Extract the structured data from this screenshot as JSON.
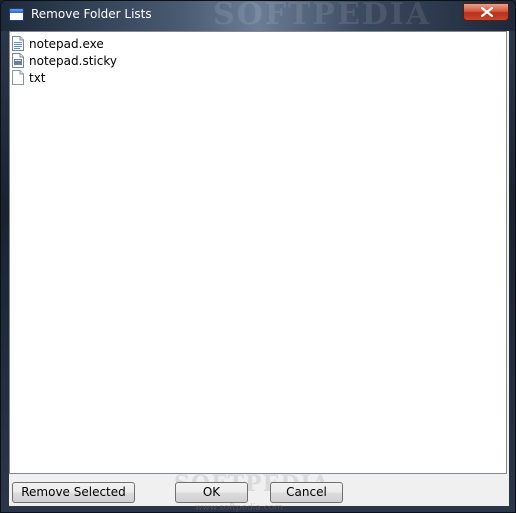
{
  "window": {
    "title": "Remove Folder Lists",
    "close_label": "close"
  },
  "watermark": {
    "top": "SOFTPEDIA",
    "bottom": "SOFTPEDIA",
    "url": "www.softpedia.com"
  },
  "list": {
    "items": [
      {
        "label": "notepad.exe",
        "icon": "executable-file-icon"
      },
      {
        "label": "notepad.sticky",
        "icon": "sticky-file-icon"
      },
      {
        "label": "txt",
        "icon": "text-file-icon"
      }
    ]
  },
  "buttons": {
    "remove_selected": "Remove Selected",
    "ok": "OK",
    "cancel": "Cancel"
  },
  "colors": {
    "titlebar_text": "#ffffff",
    "close_button": "#c9482e",
    "list_background": "#ffffff",
    "dialog_background": "#f0f0f0"
  }
}
